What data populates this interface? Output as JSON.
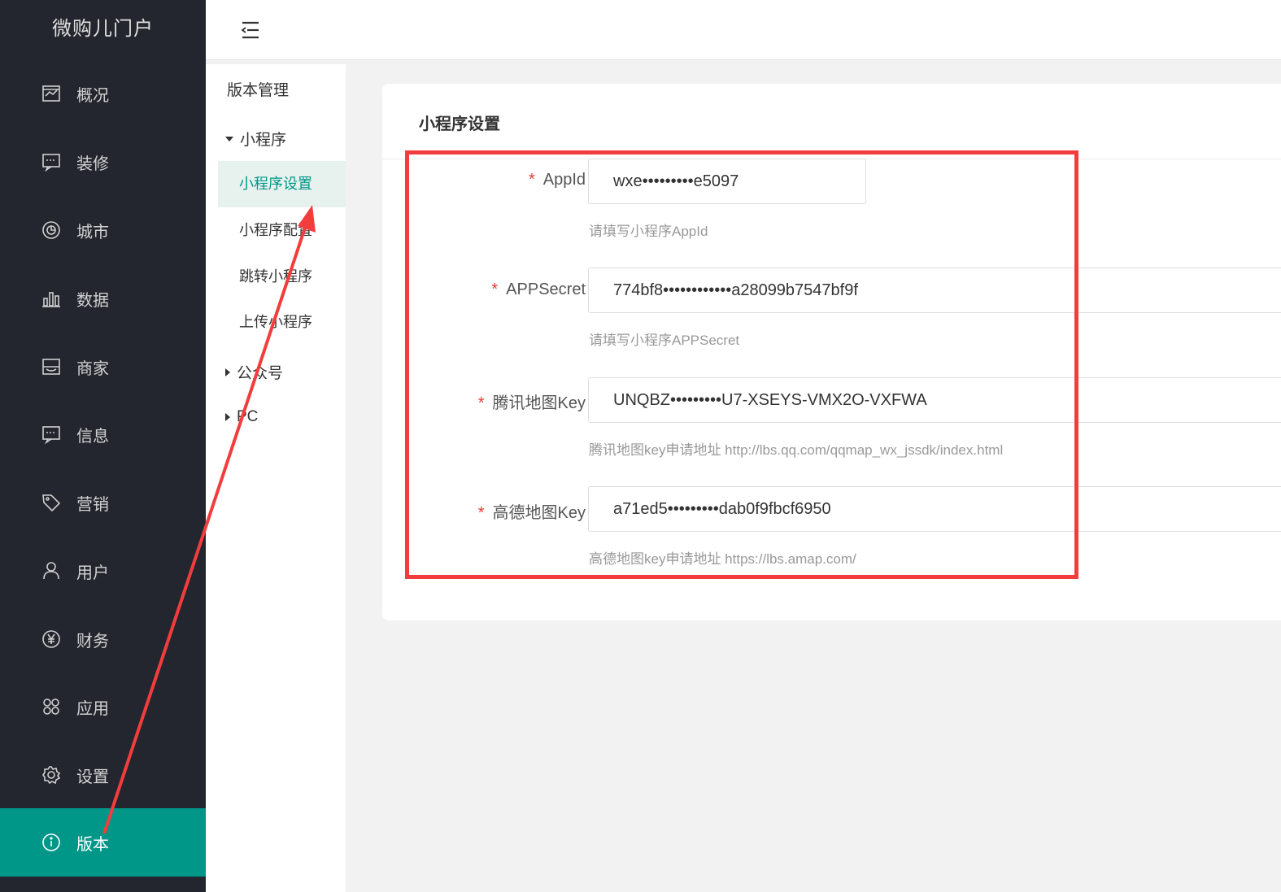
{
  "app": {
    "title": "微购儿门户"
  },
  "sidebar": {
    "items": [
      {
        "label": "概况",
        "icon": "overview-icon"
      },
      {
        "label": "装修",
        "icon": "decoration-icon"
      },
      {
        "label": "城市",
        "icon": "city-icon"
      },
      {
        "label": "数据",
        "icon": "data-chart-icon"
      },
      {
        "label": "商家",
        "icon": "merchant-icon"
      },
      {
        "label": "信息",
        "icon": "message-icon"
      },
      {
        "label": "营销",
        "icon": "tag-icon"
      },
      {
        "label": "用户",
        "icon": "user-icon"
      },
      {
        "label": "财务",
        "icon": "yen-icon"
      },
      {
        "label": "应用",
        "icon": "apps-icon"
      },
      {
        "label": "设置",
        "icon": "gear-icon"
      },
      {
        "label": "版本",
        "icon": "info-icon",
        "active": true
      }
    ]
  },
  "subnav": {
    "title": "版本管理",
    "groups": [
      {
        "label": "小程序",
        "expanded": true
      },
      {
        "label": "公众号",
        "expanded": false
      },
      {
        "label": "PC",
        "expanded": false
      }
    ],
    "items": [
      {
        "label": "小程序设置",
        "active": true
      },
      {
        "label": "小程序配置"
      },
      {
        "label": "跳转小程序"
      },
      {
        "label": "上传小程序"
      }
    ]
  },
  "card": {
    "title": "小程序设置",
    "fields": [
      {
        "required": "*",
        "label": "AppId",
        "value": "wxe•••••••••e5097",
        "hint": "请填写小程序AppId"
      },
      {
        "required": "*",
        "label": "APPSecret",
        "value": "774bf8••••••••••••a28099b7547bf9f",
        "hint": "请填写小程序APPSecret"
      },
      {
        "required": "*",
        "label": "腾讯地图Key",
        "value": "UNQBZ•••••••••U7-XSEYS-VMX2O-VXFWA",
        "hint": "腾讯地图key申请地址 http://lbs.qq.com/qqmap_wx_jssdk/index.html"
      },
      {
        "required": "*",
        "label": "高德地图Key",
        "value": "a71ed5•••••••••dab0f9fbcf6950",
        "hint": "高德地图key申请地址 https://lbs.amap.com/"
      }
    ]
  },
  "annotation_color": "#f23d3d",
  "accent_color": "#009688"
}
